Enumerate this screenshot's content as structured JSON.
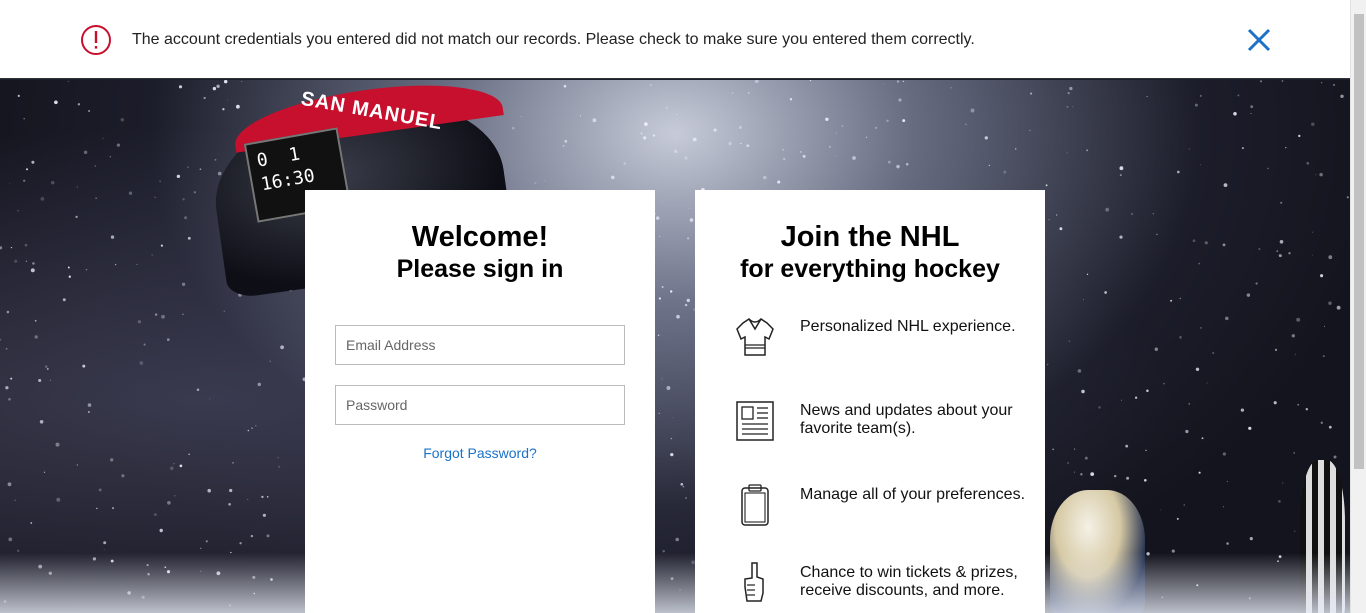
{
  "error": {
    "message": "The account credentials you entered did not match our records. Please check to make sure you entered them correctly.",
    "icon": "error-alert-icon",
    "close_icon": "close-icon",
    "accent_color": "#c8102e",
    "close_color": "#1a73c9"
  },
  "background": {
    "jumbotron_text": "SAN MANUEL",
    "score_left": "0",
    "score_right": "1",
    "clock": "16:30"
  },
  "signin": {
    "title_line1": "Welcome!",
    "title_line2": "Please sign in",
    "email_placeholder": "Email Address",
    "password_placeholder": "Password",
    "forgot_label": "Forgot Password?"
  },
  "join": {
    "title_line1": "Join the NHL",
    "title_line2": "for everything hockey",
    "benefits": [
      {
        "icon": "jersey-icon",
        "text": "Personalized NHL experience."
      },
      {
        "icon": "newspaper-icon",
        "text": "News and updates about your favorite team(s)."
      },
      {
        "icon": "clipboard-icon",
        "text": "Manage all of your preferences."
      },
      {
        "icon": "foam-finger-icon",
        "text": "Chance to win tickets & prizes, receive discounts, and more."
      }
    ]
  }
}
